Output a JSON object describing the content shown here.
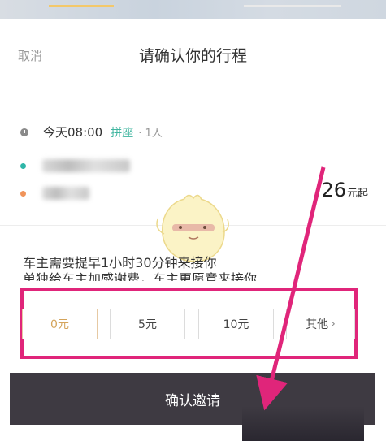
{
  "header": {
    "cancel_label": "取消",
    "title": "请确认你的行程"
  },
  "trip": {
    "time": "今天08:00",
    "mode": "拼座",
    "people": "· 1人",
    "price_value": "26",
    "price_unit": "元起"
  },
  "notice": {
    "line1": "车主需要提早1小时30分钟来接你",
    "line2": "单独给车主加感谢费，车主更愿意来接你"
  },
  "fee_options": {
    "selected": "0元",
    "items": [
      "0元",
      "5元",
      "10元",
      "其他"
    ]
  },
  "confirm_label": "确认邀请",
  "colors": {
    "accent_green": "#3fb59f",
    "selected_gold": "#d4a45b",
    "confirm_bg": "#3e3a42",
    "annotation_pink": "#e0257a"
  },
  "icons": [
    "clock-icon",
    "start-dot-icon",
    "end-dot-icon",
    "chevron-right-icon",
    "mascot-icon"
  ]
}
